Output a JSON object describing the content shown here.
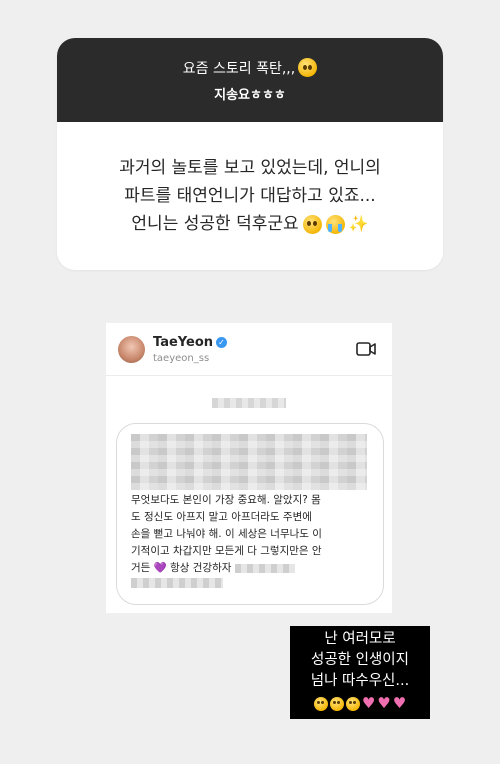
{
  "question_card": {
    "header_line1": "요즘 스토리 폭탄,,,",
    "header_line2": "지송요ㅎㅎㅎ",
    "body_line1": "과거의 놀토를 보고 있었는데, 언니의",
    "body_line2": "파트를 태연언니가 대답하고 있죠...",
    "body_line3": "언니는 성공한 덕후군요"
  },
  "dm_screenshot": {
    "name": "TaeYeon",
    "handle": "taeyeon_ss",
    "message_lines": [
      "무엇보다도 본인이 가장 중요해. 알았지? 몸",
      "도 정신도 아프지 말고 아프더라도 주변에",
      "손을 뻗고 나눠야 해. 이 세상은 너무나도 이",
      "기적이고 차갑지만 모든게 다 그렇지만은 안",
      "거든"
    ],
    "message_after_heart": "항상 건강하자"
  },
  "caption": {
    "line1": "난 여러모로",
    "line2": "성공한 인생이지",
    "line3": "넘나 따수우신..."
  }
}
